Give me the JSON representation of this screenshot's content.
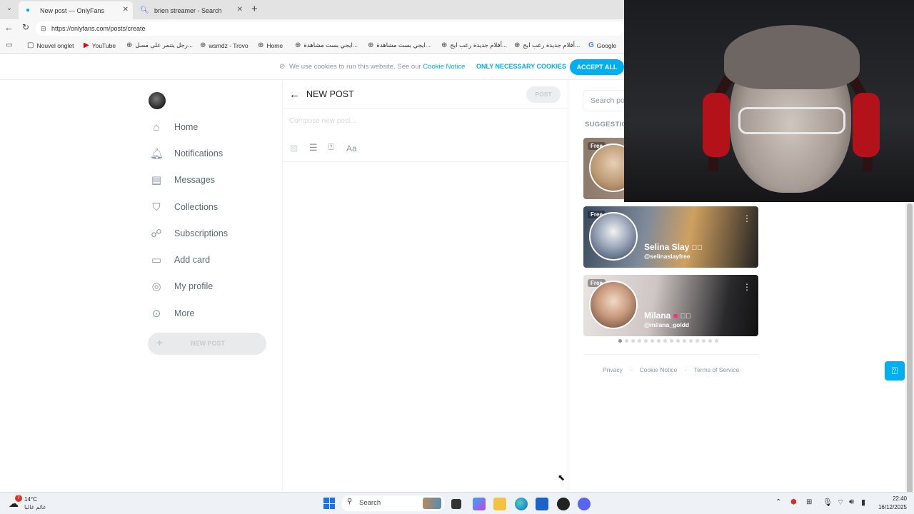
{
  "browser": {
    "tabs": [
      {
        "title": "New post — OnlyFans",
        "active": true
      },
      {
        "title": "brien streamer - Search",
        "active": false
      }
    ],
    "url": "https://onlyfans.com/posts/create",
    "bookmarks": [
      "Nouvel onglet",
      "YouTube",
      "رجل يتنمر على مسل...",
      "wsmdz - Trovo",
      "Home",
      "ايجي بست مشاهدة...",
      "ايجي بست مشاهدة...",
      "أفلام جديدة رعب ايج...",
      "أفلام جديدة رعب ايج...",
      "Google"
    ]
  },
  "cookie": {
    "text": "We use cookies to run this website. See our",
    "link": "Cookie Notice",
    "necessary_label": "ONLY NECESSARY COOKIES",
    "accept_label": "ACCEPT ALL"
  },
  "sidebar": {
    "items": [
      {
        "label": "Home",
        "icon": "home-icon"
      },
      {
        "label": "Notifications",
        "icon": "bell-icon"
      },
      {
        "label": "Messages",
        "icon": "message-icon"
      },
      {
        "label": "Collections",
        "icon": "bookmark-icon"
      },
      {
        "label": "Subscriptions",
        "icon": "subscriptions-icon"
      },
      {
        "label": "Add card",
        "icon": "card-icon"
      },
      {
        "label": "My profile",
        "icon": "profile-icon"
      },
      {
        "label": "More",
        "icon": "more-icon"
      }
    ],
    "new_post_label": "NEW POST"
  },
  "composer": {
    "title": "NEW POST",
    "post_label": "POST",
    "placeholder": "Compose new post...",
    "format_label": "Aa"
  },
  "right": {
    "search_placeholder": "Search po",
    "suggestions_label": "SUGGESTIO",
    "free_label": "Free",
    "cards": [
      {
        "name": "Selina Slay",
        "handle": "@selinaslayfree"
      },
      {
        "name": "Milana",
        "handle": "@milana_goldd"
      }
    ],
    "footer": [
      "Privacy",
      "Cookie Notice",
      "Terms of Service"
    ]
  },
  "taskbar": {
    "weather_temp": "14°C",
    "weather_desc": "غائم غالبا",
    "weather_badge": "7",
    "search_label": "Search",
    "time": "22:40",
    "date": "16/12/2025"
  },
  "colors": {
    "accent": "#00aff0",
    "nav_text": "#5b6a76"
  }
}
